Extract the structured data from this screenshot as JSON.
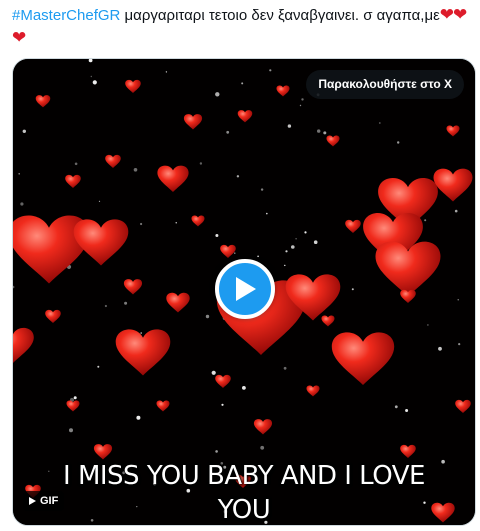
{
  "tweet": {
    "hashtag": "#MasterChefGR",
    "text": " μαργαριταρι τετοιο δεν ξαναβγαινει. σ αγαπα,με",
    "emoji": "❤❤❤"
  },
  "media": {
    "watch_label": "Παρακολουθήστε στο X",
    "caption_line1": "I MISS YOU BABY AND I LOVE",
    "caption_line2": "YOU",
    "gif_label": "GIF",
    "icons": {
      "play": "play-icon",
      "gif": "gif-play-icon"
    },
    "colors": {
      "play_button": "#1d9bf0",
      "heart": "#e01818",
      "background": "#020000"
    }
  }
}
